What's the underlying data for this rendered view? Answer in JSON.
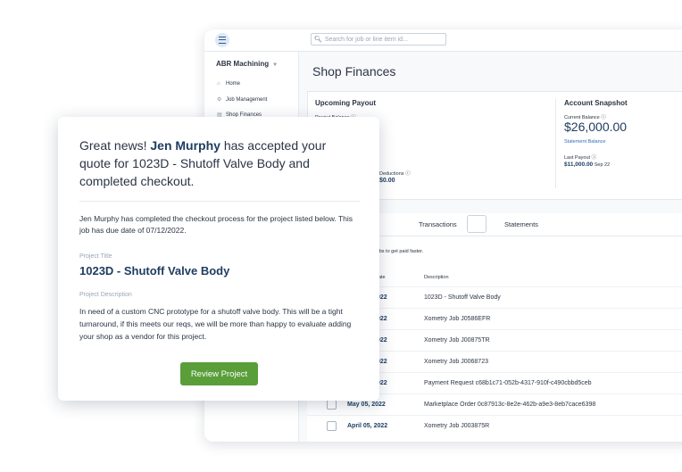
{
  "search": {
    "placeholder": "Search for job or line item id..."
  },
  "sidebar": {
    "org_name": "ABR Machining",
    "items": [
      {
        "label": "Home",
        "icon": "home-icon"
      },
      {
        "label": "Job Management",
        "icon": "job-management-icon"
      },
      {
        "label": "Shop Finances",
        "icon": "finances-icon"
      }
    ]
  },
  "page": {
    "title": "Shop Finances"
  },
  "upcoming": {
    "title": "Upcoming Payout",
    "payout_label": "Payout Balance",
    "deductions_label": "Deductions",
    "deductions_value": "$0.00"
  },
  "account": {
    "title": "Account Snapshot",
    "current_label": "Current Balance",
    "current_value": "$26,000.00",
    "statement_link": "Statement Balance",
    "last_payout_label": "Last Payout",
    "last_payout_value": "$11,000.00",
    "last_payout_date": "Sep 22"
  },
  "tabs": [
    "Transactions",
    "Statements"
  ],
  "table": {
    "hint": "re jobs to get paid faster.",
    "headers": {
      "date": "Date",
      "description": "Description"
    },
    "rows": [
      {
        "date": "022",
        "description": "1023D - Shutoff Valve Body"
      },
      {
        "date": "022",
        "description": "Xometry Job J0586EFR"
      },
      {
        "date": "022",
        "description": "Xometry Job J00875TR"
      },
      {
        "date": "022",
        "description": "Xometry Job J0068723"
      },
      {
        "date": "022",
        "description": "Payment Request c68b1c71-052b-4317-910f-c490cbbd5ceb"
      },
      {
        "date": "May 05, 2022",
        "description": "Marketplace Order 0c87913c-8e2e-462b-a9e3-8eb7cace6398"
      },
      {
        "date": "April 05, 2022",
        "description": "Xometry Job J003875R"
      }
    ]
  },
  "notification": {
    "headline_pre": "Great news! ",
    "customer": "Jen Murphy",
    "headline_post": " has accepted your quote for 1023D - Shutoff Valve Body and completed checkout.",
    "body": "Jen Murphy has completed the checkout process for the project listed below. This job has due date of 07/12/2022.",
    "project_title_label": "Project Title",
    "project_title": "1023D - Shutoff Valve Body",
    "project_desc_label": "Project Description",
    "project_desc": "In need of a custom CNC prototype for a shutoff valve body. This will be a tight turnaround, if this meets our reqs, we will be more than happy to evaluate adding your shop as a vendor for this project.",
    "button": "Review Project"
  },
  "colors": {
    "accent_green": "#5a9e3a",
    "navy": "#1f3d60",
    "link_blue": "#2f6fbd"
  }
}
